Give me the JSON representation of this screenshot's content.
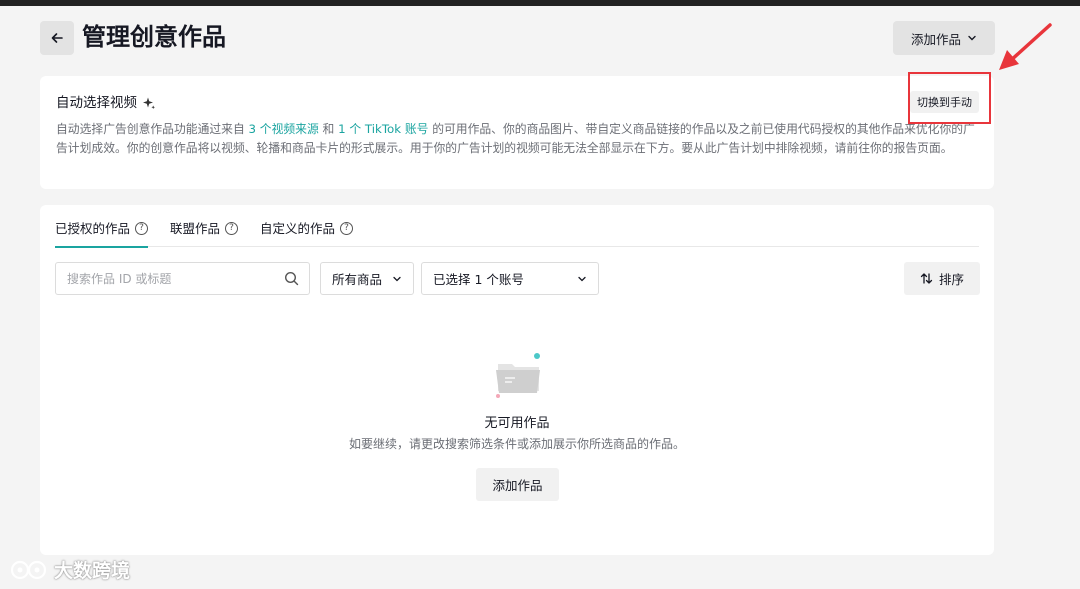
{
  "header": {
    "title": "管理创意作品",
    "add_work_label": "添加作品"
  },
  "auto_section": {
    "title": "自动选择视频",
    "switch_label": "切换到手动",
    "desc_part1": "自动选择广告创意作品功能通过来自",
    "desc_link1": " 3 个视频来源 ",
    "desc_part2": "和",
    "desc_link2": " 1 个 TikTok 账号 ",
    "desc_part3": "的可用作品、你的商品图片、带自定义商品链接的作品以及之前已使用代码授权的其他作品来优化你的广告计划成效。你的创意作品将以视频、轮播和商品卡片的形式展示。用于你的广告计划的视频可能无法全部显示在下方。要从此广告计划中排除视频，请前往你的报告页面。"
  },
  "tabs": [
    {
      "label": "已授权的作品",
      "active": true
    },
    {
      "label": "联盟作品",
      "active": false
    },
    {
      "label": "自定义的作品",
      "active": false
    }
  ],
  "filters": {
    "search_placeholder": "搜索作品 ID 或标题",
    "product_select": "所有商品",
    "account_select": "已选择 1 个账号",
    "sort_label": "排序"
  },
  "empty_state": {
    "title": "无可用作品",
    "description": "如要继续，请更改搜索筛选条件或添加展示你所选商品的作品。",
    "add_label": "添加作品"
  },
  "watermark": {
    "text": "大数跨境"
  },
  "colors": {
    "accent": "#1aa4a0",
    "highlight_box": "#e8353b"
  }
}
